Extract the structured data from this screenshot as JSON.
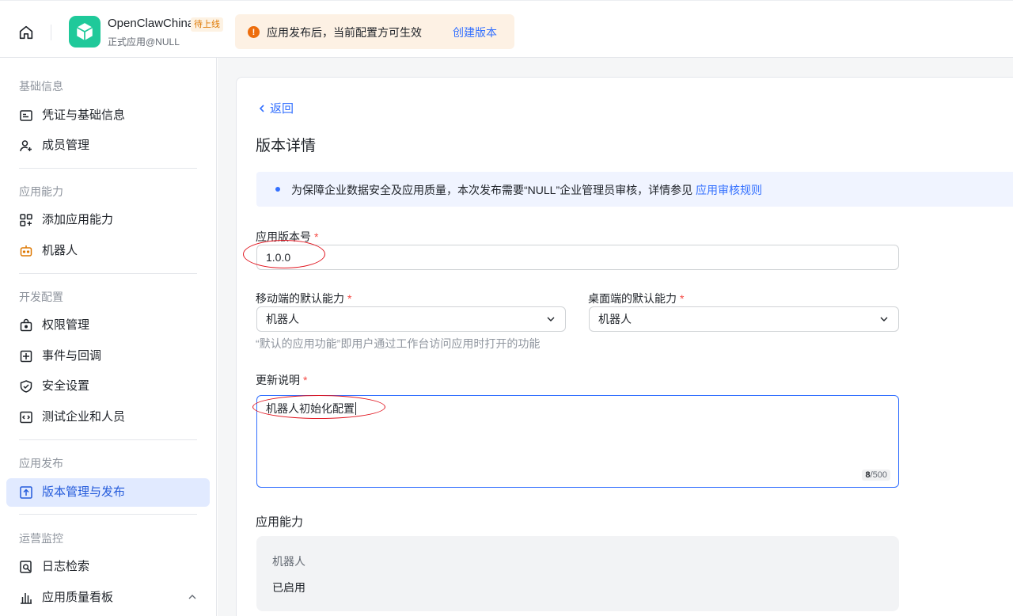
{
  "header": {
    "app_name": "OpenClawChina",
    "app_tag": "待上线",
    "app_sub": "正式应用@NULL",
    "notice_text": "应用发布后，当前配置方可生效",
    "notice_link": "创建版本",
    "colors": {
      "logo": "#1fc99a",
      "notice_bg": "#fdf1e4",
      "warning": "#ed6d0c",
      "link": "#3370ff"
    }
  },
  "sidebar": {
    "sections": [
      {
        "title": "基础信息",
        "items": [
          {
            "label": "凭证与基础信息",
            "icon": "credential-card-icon"
          },
          {
            "label": "成员管理",
            "icon": "add-member-icon"
          }
        ]
      },
      {
        "title": "应用能力",
        "items": [
          {
            "label": "添加应用能力",
            "icon": "add-capability-grid-icon"
          },
          {
            "label": "机器人",
            "icon": "robot-icon"
          }
        ]
      },
      {
        "title": "开发配置",
        "items": [
          {
            "label": "权限管理",
            "icon": "permission-lock-icon"
          },
          {
            "label": "事件与回调",
            "icon": "event-callback-icon"
          },
          {
            "label": "安全设置",
            "icon": "shield-check-icon"
          },
          {
            "label": "测试企业和人员",
            "icon": "code-test-icon"
          }
        ]
      },
      {
        "title": "应用发布",
        "items": [
          {
            "label": "版本管理与发布",
            "icon": "upload-version-icon",
            "active": true
          }
        ]
      },
      {
        "title": "运营监控",
        "items": [
          {
            "label": "日志检索",
            "icon": "log-search-icon"
          },
          {
            "label": "应用质量看板",
            "icon": "bar-chart-icon"
          }
        ]
      }
    ]
  },
  "main": {
    "back_label": "返回",
    "title": "版本详情",
    "info_text": "为保障企业数据安全及应用质量，本次发布需要“NULL”企业管理员审核，详情参见",
    "info_link": "应用审核规则",
    "version_label": "应用版本号",
    "version_value": "1.0.0",
    "mobile_label": "移动端的默认能力",
    "mobile_value": "机器人",
    "desktop_label": "桌面端的默认能力",
    "desktop_value": "机器人",
    "hint": "“默认的应用功能”即用户通过工作台访问应用时打开的功能",
    "notes_label": "更新说明",
    "notes_value": "机器人初始化配置",
    "notes_count": "8",
    "notes_max": "/500",
    "capability_title": "应用能力",
    "capability_name": "机器人",
    "capability_status": "已启用",
    "required_mark": "*"
  }
}
